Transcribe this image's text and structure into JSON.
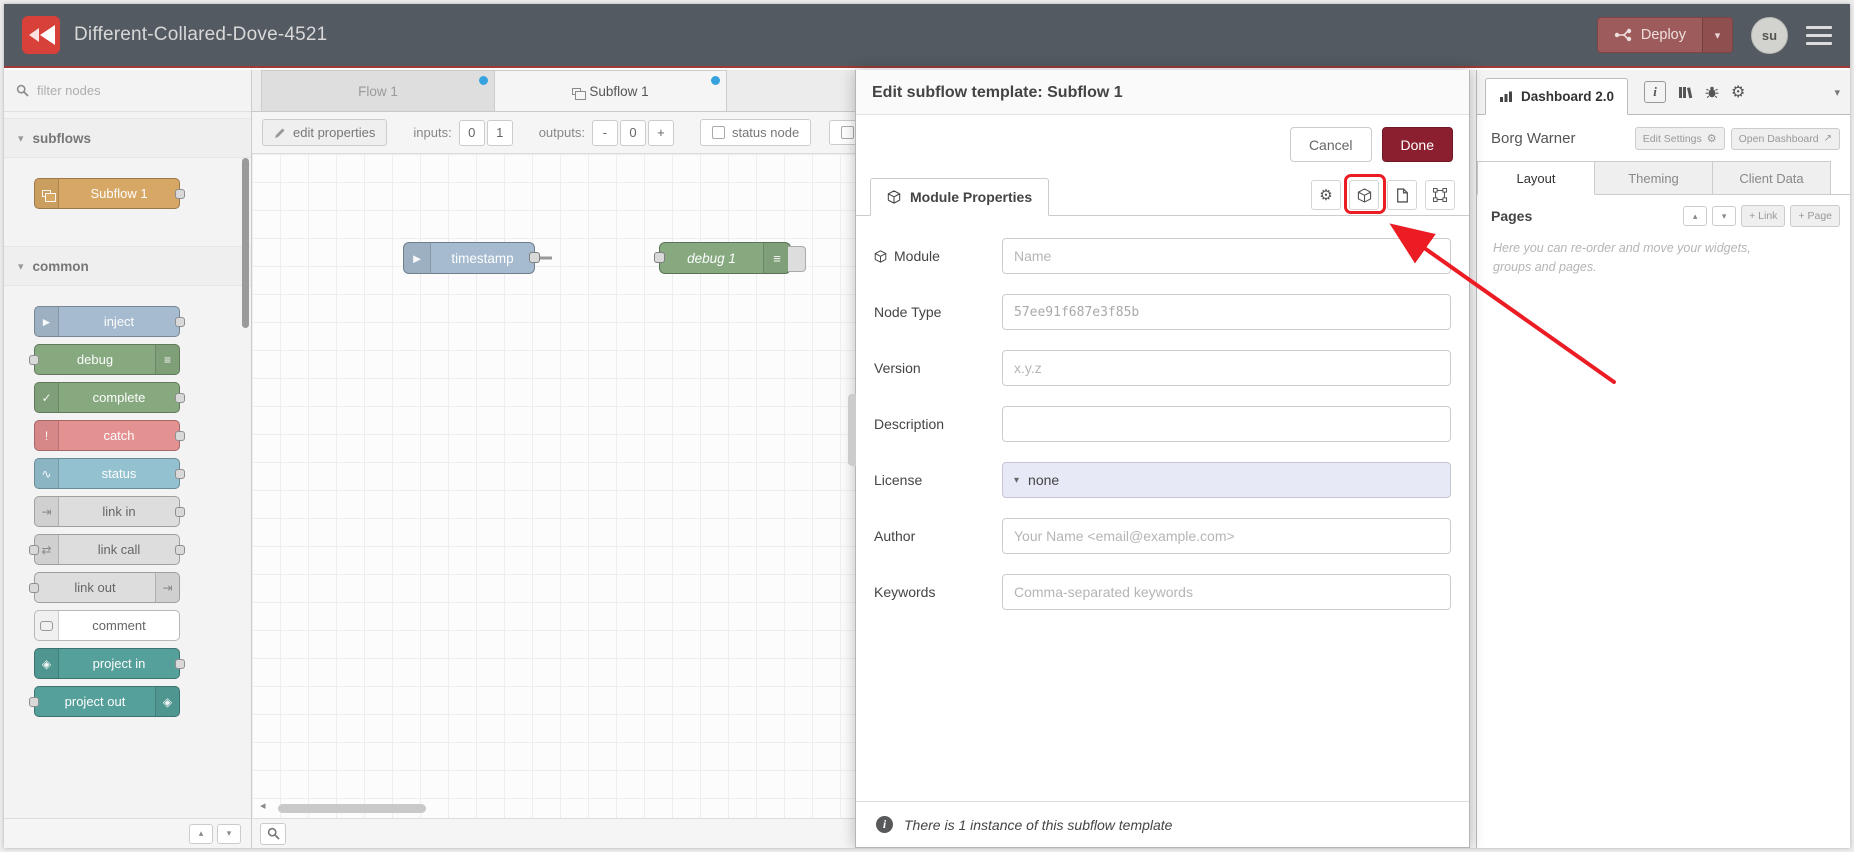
{
  "header": {
    "title": "Different-Collared-Dove-4521",
    "deploy": {
      "label": "Deploy"
    },
    "user": {
      "initials": "su"
    }
  },
  "palette": {
    "filter_placeholder": "filter nodes",
    "sections": [
      {
        "label": "subflows",
        "nodes": [
          {
            "label": "Subflow 1"
          }
        ]
      },
      {
        "label": "common",
        "nodes": [
          {
            "label": "inject",
            "glyph": "►"
          },
          {
            "label": "debug",
            "glyph": "≡"
          },
          {
            "label": "complete",
            "glyph": "✓"
          },
          {
            "label": "catch",
            "glyph": "!"
          },
          {
            "label": "status",
            "glyph": "∿"
          },
          {
            "label": "link in",
            "glyph": "⇥"
          },
          {
            "label": "link call",
            "glyph": "⇄"
          },
          {
            "label": "link out",
            "glyph": "⇥"
          },
          {
            "label": "comment"
          },
          {
            "label": "project in",
            "glyph": "◈"
          },
          {
            "label": "project out",
            "glyph": "◈"
          }
        ]
      }
    ]
  },
  "workspace": {
    "tabs": [
      {
        "label": "Flow 1"
      },
      {
        "label": "Subflow 1"
      }
    ],
    "toolbar": {
      "edit_properties": "edit properties",
      "inputs_label": "inputs:",
      "input_values": [
        "0",
        "1"
      ],
      "outputs_label": "outputs:",
      "output_controls": [
        "-",
        "0",
        "+"
      ],
      "status_node": "status node"
    },
    "canvas_nodes": [
      {
        "label": "timestamp",
        "glyph": "►"
      },
      {
        "label": "debug 1",
        "glyph": "≡"
      }
    ]
  },
  "dialog": {
    "title": "Edit subflow template: Subflow 1",
    "cancel": "Cancel",
    "done": "Done",
    "tab": "Module Properties",
    "form": {
      "module_label": "Module",
      "module_placeholder": "Name",
      "node_type_label": "Node Type",
      "node_type_placeholder": "57ee91f687e3f85b",
      "version_label": "Version",
      "version_placeholder": "x.y.z",
      "description_label": "Description",
      "license_label": "License",
      "license_value": "none",
      "author_label": "Author",
      "author_placeholder": "Your Name <email@example.com>",
      "keywords_label": "Keywords",
      "keywords_placeholder": "Comma-separated keywords"
    },
    "footer": "There is 1 instance of this subflow template"
  },
  "sidebar": {
    "active_tab": "Dashboard 2.0",
    "instance_name": "Borg Warner",
    "edit_settings": "Edit Settings",
    "open_dashboard": "Open Dashboard",
    "tabs": [
      "Layout",
      "Theming",
      "Client Data"
    ],
    "pages_label": "Pages",
    "add_link": "+ Link",
    "add_page": "+ Page",
    "help_text": "Here you can re-order and move your widgets, groups and pages."
  },
  "icons": {
    "header": [
      "app-logo",
      "deploy-pipeline-icon",
      "menu-icon"
    ],
    "dialog_tab_icons": [
      "gear-icon",
      "module-cube-icon",
      "description-doc-icon",
      "appearance-icon"
    ],
    "sidebar_toolbar_icons": [
      "info-icon",
      "library-icon",
      "bug-icon",
      "gear-icon",
      "caret-down-icon"
    ],
    "annotation": [
      "highlight-box",
      "red-arrow"
    ]
  },
  "colors": {
    "accent_red": "#8b1f2f",
    "annotation_red": "#ec1c24",
    "header_bg": "#535a61",
    "tab_dot_blue": "#36a3e0"
  }
}
